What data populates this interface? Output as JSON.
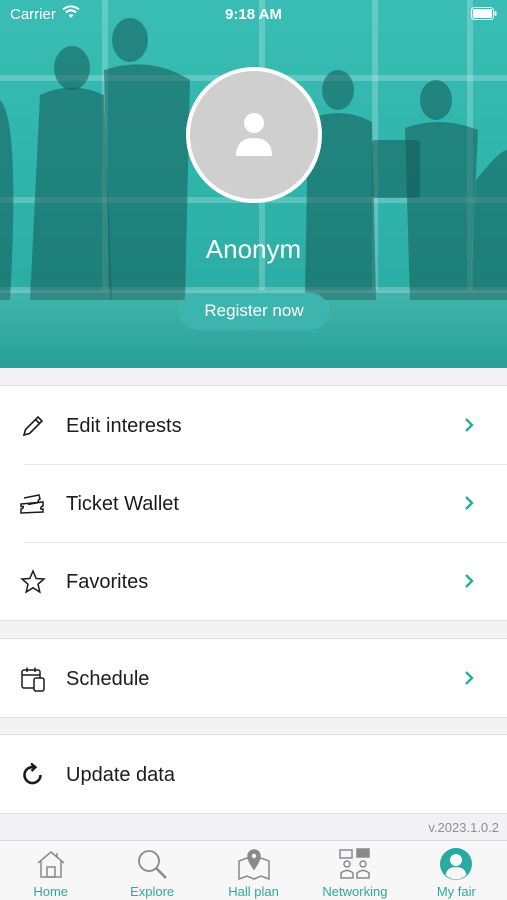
{
  "status_bar": {
    "carrier": "Carrier",
    "time": "9:18 AM"
  },
  "profile": {
    "name": "Anonym",
    "register_label": "Register now"
  },
  "menu": {
    "group1": [
      {
        "label": "Edit interests",
        "icon": "pencil-icon"
      },
      {
        "label": "Ticket Wallet",
        "icon": "tickets-icon"
      },
      {
        "label": "Favorites",
        "icon": "star-icon"
      }
    ],
    "group2": [
      {
        "label": "Schedule",
        "icon": "calendar-icon"
      }
    ],
    "group3": [
      {
        "label": "Update data",
        "icon": "refresh-icon"
      }
    ]
  },
  "version": "v.2023.1.0.2",
  "tabs": [
    {
      "label": "Home",
      "icon": "home-icon"
    },
    {
      "label": "Explore",
      "icon": "search-icon"
    },
    {
      "label": "Hall plan",
      "icon": "map-icon"
    },
    {
      "label": "Networking",
      "icon": "networking-icon"
    },
    {
      "label": "My fair",
      "icon": "user-icon",
      "active": true
    }
  ],
  "colors": {
    "accent": "#28aaa2",
    "hero": "#33b8b0"
  }
}
